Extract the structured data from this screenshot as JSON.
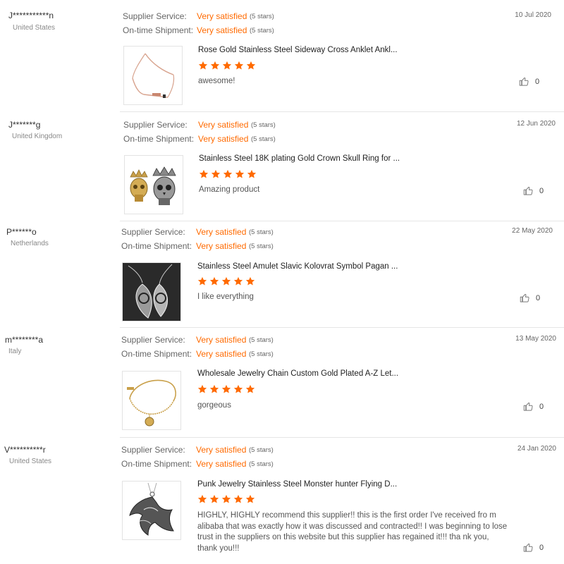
{
  "labels": {
    "supplier_service": "Supplier Service:",
    "ontime_shipment": "On-time Shipment:"
  },
  "colors": {
    "accent": "#ff6a00",
    "muted": "#666666",
    "divider": "#e6e6e6"
  },
  "icons": {
    "rating": "star-icon",
    "like": "thumbs-up-icon"
  },
  "reviews": [
    {
      "buyer": "J***********n",
      "country": "United States",
      "date": "10 Jul 2020",
      "supplier_service": {
        "text": "Very satisfied",
        "stars": "(5 stars)"
      },
      "ontime_shipment": {
        "text": "Very satisfied",
        "stars": "(5 stars)"
      },
      "product_title": "Rose Gold Stainless Steel Sideway Cross Anklet Ankl...",
      "product_image": "rose-gold-anklet",
      "rating": 5,
      "comment": "awesome!",
      "likes": "0"
    },
    {
      "buyer": "J*******g",
      "country": "United Kingdom",
      "date": "12 Jun 2020",
      "supplier_service": {
        "text": "Very satisfied",
        "stars": "(5 stars)"
      },
      "ontime_shipment": {
        "text": "Very satisfied",
        "stars": "(5 stars)"
      },
      "product_title": "Stainless Steel 18K plating Gold Crown Skull Ring for ...",
      "product_image": "crown-skull-rings",
      "rating": 5,
      "comment": "Amazing product",
      "likes": "0"
    },
    {
      "buyer": "P******o",
      "country": "Netherlands",
      "date": "22 May 2020",
      "supplier_service": {
        "text": "Very satisfied",
        "stars": "(5 stars)"
      },
      "ontime_shipment": {
        "text": "Very satisfied",
        "stars": "(5 stars)"
      },
      "product_title": "Stainless Steel Amulet Slavic Kolovrat Symbol Pagan ...",
      "product_image": "kolovrat-amulet",
      "rating": 5,
      "comment": "I like everything",
      "likes": "0"
    },
    {
      "buyer": "m********a",
      "country": "Italy",
      "date": "13 May 2020",
      "supplier_service": {
        "text": "Very satisfied",
        "stars": "(5 stars)"
      },
      "ontime_shipment": {
        "text": "Very satisfied",
        "stars": "(5 stars)"
      },
      "product_title": "Wholesale Jewelry Chain Custom Gold Plated A-Z Let...",
      "product_image": "gold-letter-bracelet",
      "rating": 5,
      "comment": "gorgeous",
      "likes": "0"
    },
    {
      "buyer": "V**********r",
      "country": "United States",
      "date": "24 Jan 2020",
      "supplier_service": {
        "text": "Very satisfied",
        "stars": "(5 stars)"
      },
      "ontime_shipment": {
        "text": "Very satisfied",
        "stars": "(5 stars)"
      },
      "product_title": "Punk Jewelry Stainless Steel Monster hunter Flying D...",
      "product_image": "dragon-pendant",
      "rating": 5,
      "comment": "HIGHLY,  HIGHLY recommend this supplier!! this is the first order I've received fro m alibaba that was exactly how it was discussed and contracted!! I was beginning to lose trust in the suppliers on this website but this supplier has regained it!!! tha nk you, thank you!!!",
      "likes": "0"
    }
  ]
}
